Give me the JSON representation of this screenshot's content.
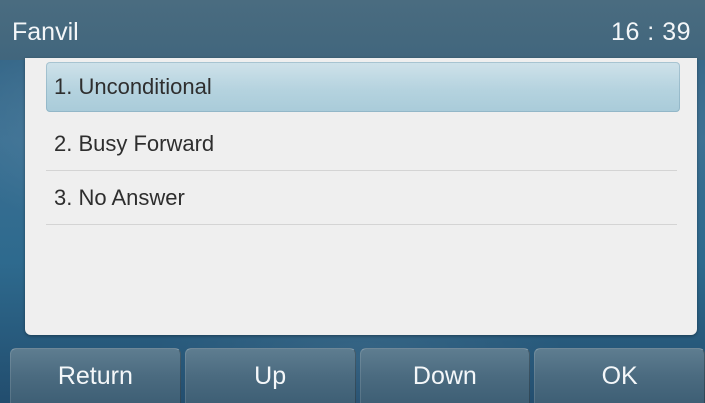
{
  "status_bar": {
    "brand": "Fanvil",
    "time": "16 : 39"
  },
  "menu": {
    "selected_index": 0,
    "items": [
      {
        "label": "1. Unconditional"
      },
      {
        "label": "2. Busy Forward"
      },
      {
        "label": "3. No Answer"
      }
    ]
  },
  "softkeys": [
    {
      "label": "Return"
    },
    {
      "label": "Up"
    },
    {
      "label": "Down"
    },
    {
      "label": "OK"
    }
  ],
  "colors": {
    "selection_highlight": "#b5d3df",
    "panel_background": "#efefef",
    "wallpaper": "#2f5f80"
  }
}
